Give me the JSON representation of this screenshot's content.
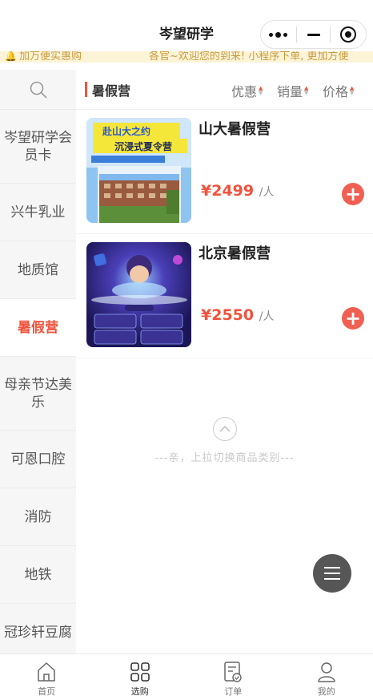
{
  "navbar": {
    "title": "岑望研学"
  },
  "notice": {
    "left_text": "加万便实惠购",
    "right_text": "各官~欢迎您的到来! 小程序下单, 更加方便"
  },
  "sidebar": {
    "search_icon": "search-icon",
    "categories": [
      {
        "label": "岑望研学会员卡"
      },
      {
        "label": "兴牛乳业"
      },
      {
        "label": "地质馆"
      },
      {
        "label": "暑假营"
      },
      {
        "label": "母亲节达美乐"
      },
      {
        "label": "可恩口腔"
      },
      {
        "label": "消防"
      },
      {
        "label": "地铁"
      },
      {
        "label": "冠珍轩豆腐"
      }
    ],
    "active_index": 3
  },
  "sort_bar": {
    "current": "暑假营",
    "options": [
      {
        "label": "优惠"
      },
      {
        "label": "销量"
      },
      {
        "label": "价格"
      }
    ]
  },
  "products": [
    {
      "name": "山大暑假营",
      "price": "¥2499",
      "unit": "/人",
      "banner_line1": "赴山大之约",
      "banner_line2": "沉浸式夏令营"
    },
    {
      "name": "北京暑假营",
      "price": "¥2550",
      "unit": "/人"
    }
  ],
  "pull_up": {
    "text": "---亲，上拉切换商品类别---"
  },
  "tabbar": {
    "tabs": [
      {
        "label": "首页",
        "icon": "home-icon"
      },
      {
        "label": "选购",
        "icon": "grid-icon"
      },
      {
        "label": "订单",
        "icon": "order-icon"
      },
      {
        "label": "我的",
        "icon": "user-icon"
      }
    ],
    "active_index": 1
  },
  "colors": {
    "accent": "#f0533d",
    "notice_bg": "#fdf4d7",
    "sidebar_bg": "#f6f6f6"
  }
}
